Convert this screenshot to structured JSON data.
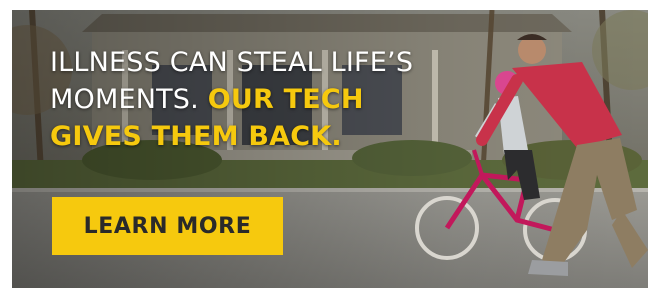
{
  "ad": {
    "headline_line1": "ILLNESS CAN STEAL LIFE’S",
    "headline_line2_white": "MOMENTS. ",
    "headline_line2_yellow": "OUR TECH",
    "headline_line3_yellow": "GIVES THEM BACK.",
    "cta_label": "LEARN MORE"
  },
  "colors": {
    "accent_yellow": "#f6c90e",
    "headline_white": "#ffffff",
    "cta_text": "#2a2a2a"
  },
  "scene": {
    "subjects": [
      "father-figure",
      "child-on-bicycle"
    ],
    "bicycle_color": "#c2185b",
    "shirt_color": "#c8324a"
  }
}
